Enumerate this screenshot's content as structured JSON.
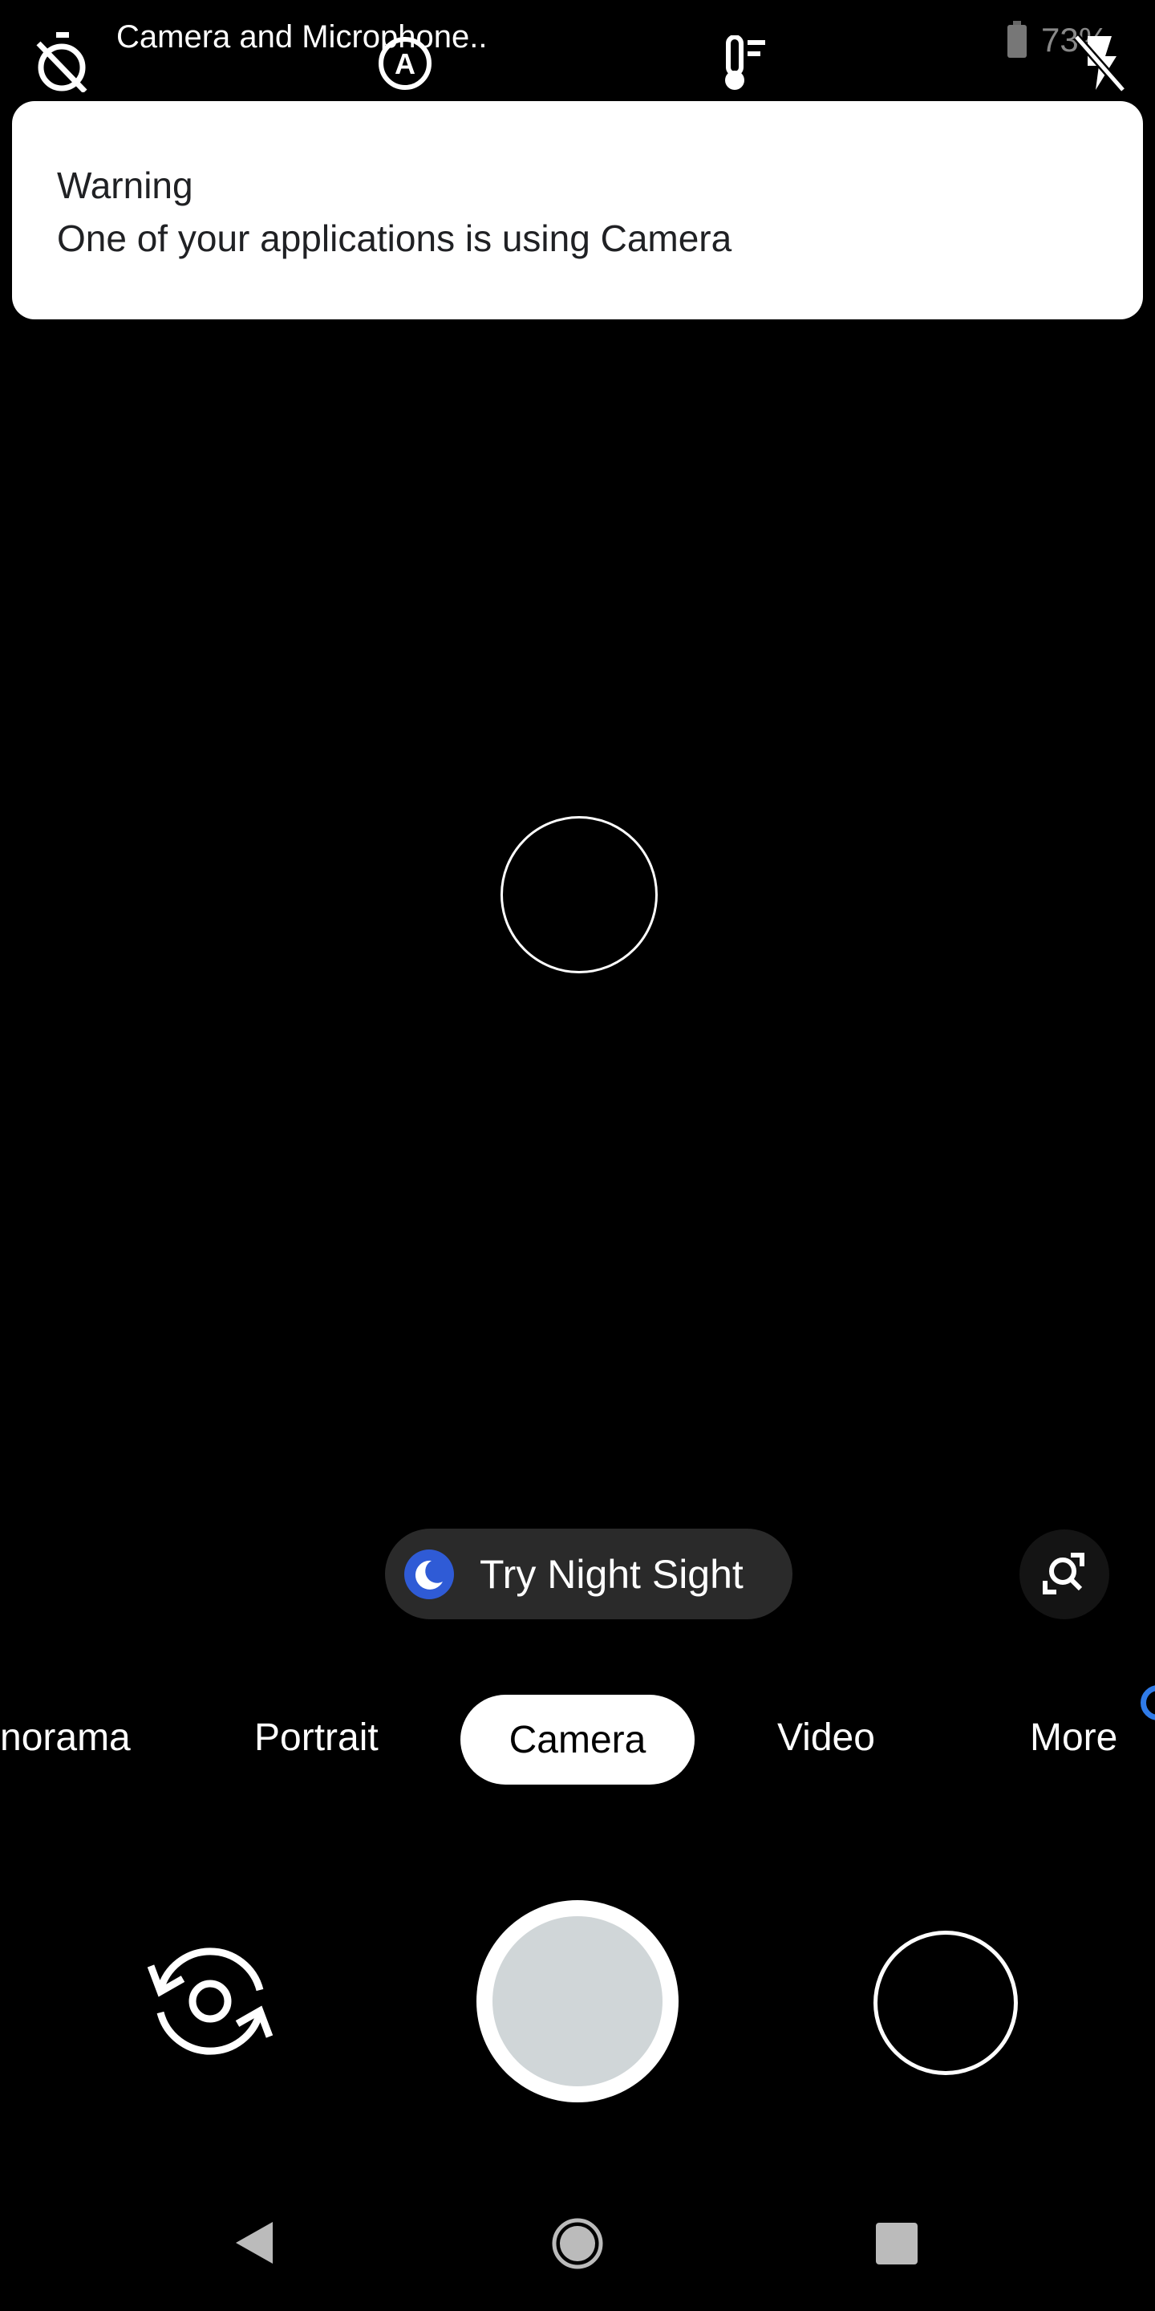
{
  "status_bar": {
    "notification_text": "Camera and Microphone..",
    "battery": "73%",
    "icons": [
      "timer-off-icon",
      "auto-mode-icon",
      "thermometer-icon",
      "battery-icon",
      "flash-off-icon"
    ]
  },
  "notification": {
    "title": "Warning",
    "body": "One of your applications is using Camera"
  },
  "suggestion": {
    "label": "Try Night Sight",
    "icon": "moon-icon",
    "accent": "#2f5bd6"
  },
  "modes": {
    "items": [
      {
        "label": "norama"
      },
      {
        "label": "Portrait"
      },
      {
        "label": "Camera",
        "active": true
      },
      {
        "label": "Video"
      },
      {
        "label": "More"
      }
    ]
  },
  "nav": {
    "icons": [
      "back-icon",
      "home-icon",
      "recents-icon"
    ]
  }
}
